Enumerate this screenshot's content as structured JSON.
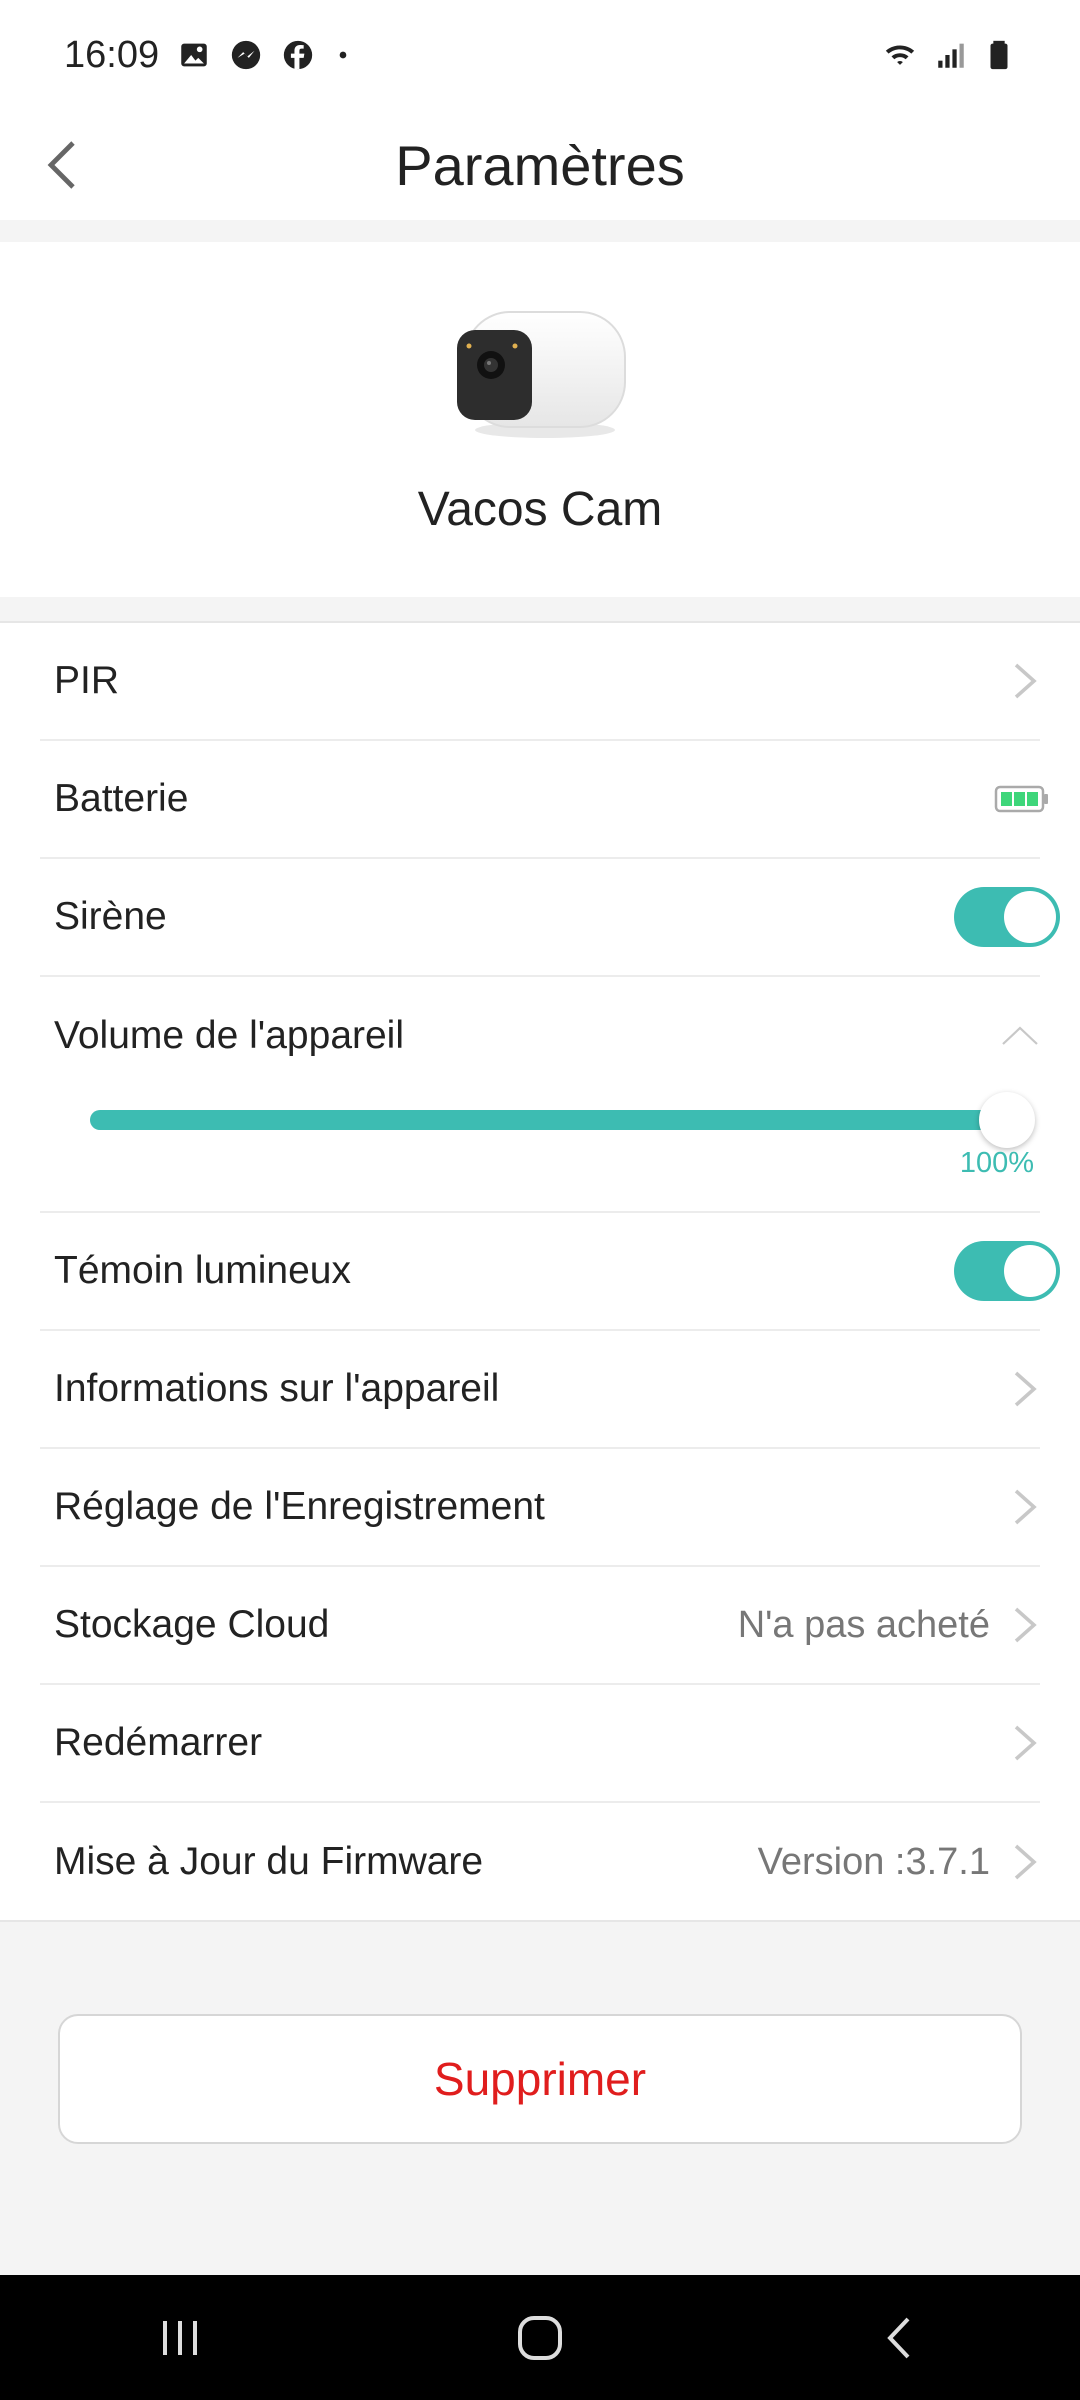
{
  "status_bar": {
    "time": "16:09",
    "icons_left": [
      "image-icon",
      "messenger-icon",
      "facebook-icon",
      "dot-icon"
    ],
    "icons_right": [
      "wifi-icon",
      "signal-icon",
      "battery-icon"
    ]
  },
  "header": {
    "title": "Paramètres",
    "back_icon": "chevron-left-icon"
  },
  "device": {
    "name": "Vacos Cam",
    "image_icon": "camera-device-image"
  },
  "settings": {
    "pir": {
      "label": "PIR"
    },
    "battery": {
      "label": "Batterie",
      "level": 1.0
    },
    "siren": {
      "label": "Sirène",
      "enabled": true
    },
    "volume": {
      "label": "Volume de l'appareil",
      "value_text": "100%",
      "value": 100
    },
    "indicator": {
      "label": "Témoin lumineux",
      "enabled": true
    },
    "device_info": {
      "label": "Informations sur l'appareil"
    },
    "recording": {
      "label": "Réglage de l'Enregistrement"
    },
    "cloud": {
      "label": "Stockage Cloud",
      "value": "N'a pas acheté"
    },
    "restart": {
      "label": "Redémarrer"
    },
    "firmware": {
      "label": "Mise à Jour du Firmware",
      "value": "Version :3.7.1"
    }
  },
  "actions": {
    "delete_label": "Supprimer"
  },
  "colors": {
    "accent": "#3dbcb2",
    "danger": "#e01d1d",
    "battery_green": "#3ed67a"
  },
  "nav_bar": {
    "buttons": [
      "recent-apps-icon",
      "home-icon",
      "back-icon"
    ]
  }
}
